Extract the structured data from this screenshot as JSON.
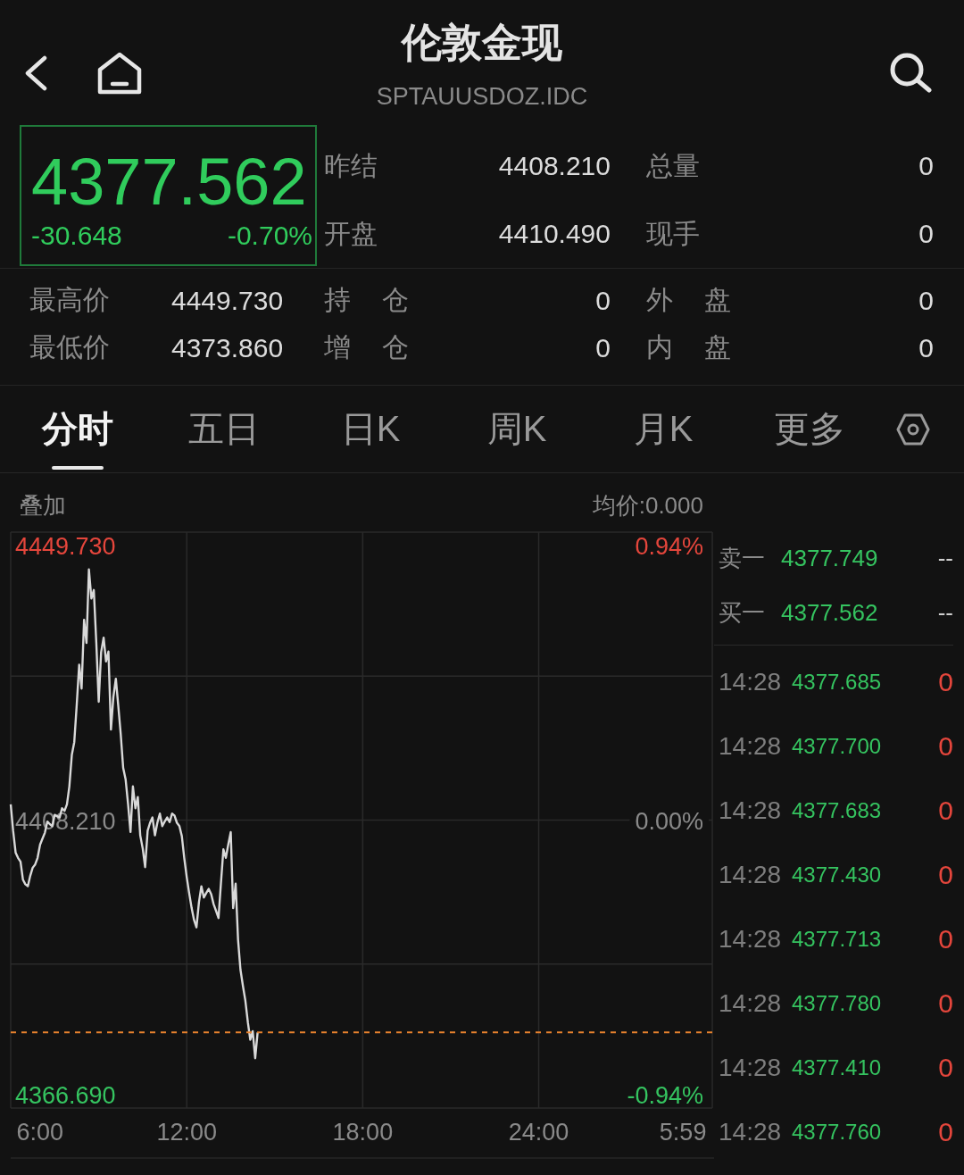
{
  "header": {
    "title": "伦敦金现",
    "code": "SPTAUUSDOZ.IDC"
  },
  "quote": {
    "price": "4377.562",
    "change": "-30.648",
    "change_pct": "-0.70%",
    "rising": false
  },
  "stats": [
    {
      "label": "昨结",
      "value": "4408.210"
    },
    {
      "label": "总量",
      "value": "0"
    },
    {
      "label": "开盘",
      "value": "4410.490"
    },
    {
      "label": "现手",
      "value": "0"
    }
  ],
  "details": [
    {
      "label": "最高价",
      "value": "4449.730"
    },
    {
      "label": "持 仓",
      "value": "0"
    },
    {
      "label": "外 盘",
      "value": "0"
    },
    {
      "label": "最低价",
      "value": "4373.860"
    },
    {
      "label": "增 仓",
      "value": "0"
    },
    {
      "label": "内 盘",
      "value": "0"
    }
  ],
  "tabs": [
    {
      "label": "分时",
      "selected": true
    },
    {
      "label": "五日",
      "selected": false
    },
    {
      "label": "日K",
      "selected": false
    },
    {
      "label": "周K",
      "selected": false
    },
    {
      "label": "月K",
      "selected": false
    },
    {
      "label": "更多",
      "selected": false
    }
  ],
  "chart": {
    "overlay": "叠加",
    "average": "均价:0.000",
    "percent_labels": [
      "0.94%",
      "0.00%",
      "-0.94%"
    ],
    "chart_data": {
      "type": "line",
      "categories": [
        null,
        null,
        null,
        null,
        null,
        null,
        null,
        null,
        null,
        null,
        null,
        null,
        "6:00",
        null,
        null,
        null,
        null,
        null,
        null,
        null,
        null,
        null,
        null,
        null,
        null,
        null,
        null,
        null,
        null,
        null,
        null,
        null,
        null,
        null,
        null,
        null,
        null,
        null,
        null,
        null,
        null,
        null,
        null,
        null,
        null,
        null,
        null,
        null,
        null,
        null,
        null,
        null,
        null,
        null,
        null,
        null,
        null,
        null,
        null,
        null,
        null,
        null,
        null,
        null,
        null,
        null,
        null,
        null,
        null,
        null,
        null,
        null,
        "12:00",
        null,
        null,
        null,
        null,
        null,
        null,
        null,
        null,
        null,
        null,
        null,
        null,
        null,
        null,
        null,
        null,
        null,
        null,
        null,
        null,
        null,
        null,
        null,
        null,
        null,
        null,
        null,
        null,
        null,
        null,
        null,
        null,
        null,
        null,
        null,
        null,
        null,
        null,
        null,
        null,
        null,
        null,
        null,
        null,
        null,
        null,
        null,
        null,
        null,
        null,
        null,
        null,
        null,
        null,
        null,
        null,
        null,
        null,
        null,
        null,
        null,
        null,
        null,
        null,
        null,
        null,
        null,
        null,
        null,
        null,
        null,
        "18:00",
        null,
        null,
        null,
        null,
        null,
        null,
        null,
        null,
        null,
        null,
        null,
        null,
        null,
        null,
        null,
        null,
        null,
        null,
        null,
        null,
        null,
        null,
        null,
        null,
        null,
        null,
        null,
        null,
        null,
        null,
        null,
        null,
        null,
        null,
        null,
        null,
        null,
        null,
        null,
        null,
        null,
        null,
        null,
        null,
        null,
        null,
        null,
        null,
        null,
        null,
        null,
        null,
        null,
        null,
        null,
        null,
        null,
        null,
        null,
        null,
        null,
        null,
        null,
        null,
        null,
        null,
        null,
        null,
        null,
        null,
        null,
        "24:00",
        null,
        null,
        null,
        null,
        null,
        null,
        null,
        null,
        null,
        null,
        null,
        null,
        null,
        null,
        null,
        null,
        null,
        null,
        null,
        null,
        null,
        null,
        null,
        null,
        null,
        null,
        null,
        null,
        null,
        null,
        null,
        null,
        null,
        null,
        null,
        null,
        null,
        null,
        null,
        null,
        null,
        null,
        null,
        null,
        null,
        null,
        null,
        null,
        null,
        null,
        null,
        null,
        null,
        null,
        null,
        null,
        null,
        null,
        "5:59",
        null,
        null,
        null,
        null,
        null,
        null,
        null,
        null,
        null,
        null,
        null,
        null
      ],
      "series": [
        {
          "color": "#d9d9d9",
          "values": [
            4410.6,
            4406.6,
            4403.3,
            4402.5,
            4401.9,
            4399.2,
            4398.5,
            4398.2,
            4399.8,
            4401.0,
            4401.5,
            4402.5,
            4404.5,
            4405.4,
            4406.3,
            4408.0,
            4407.6,
            4407.3,
            4409.0,
            4408.8,
            4408.6,
            4410.0,
            4409.6,
            4410.6,
            4413.3,
            4418.1,
            4420.0,
            4425.5,
            4431.7,
            4428.1,
            4438.5,
            4435.0,
            4446.1,
            4441.7,
            4443.0,
            4435.0,
            4426.1,
            4433.6,
            4435.8,
            4432.2,
            4433.7,
            4421.9,
            4426.8,
            4429.6,
            4425.5,
            4421.3,
            4416.1,
            4414.4,
            4410.6,
            4406.4,
            4413.3,
            4410.0,
            4411.7,
            4405.9,
            4403.9,
            4401.1,
            4406.6,
            4407.8,
            4408.6,
            4405.9,
            4407.8,
            4409.2,
            4407.3,
            4408.0,
            4408.6,
            4407.9,
            4409.2,
            4408.9,
            4407.8,
            4407.3,
            4405.8,
            4402.5,
            4399.6,
            4397.2,
            4394.9,
            4393.1,
            4392.0,
            4395.8,
            4398.2,
            4396.5,
            4397.2,
            4397.8,
            4397.0,
            4395.5,
            4394.5,
            4393.4,
            4398.6,
            4403.8,
            4402.5,
            4404.5,
            4406.4,
            4394.9,
            4398.6,
            4390.1,
            4385.6,
            4383.1,
            4380.9,
            4377.6,
            4375.0,
            4376.3,
            4372.2,
            4376.1,
            null,
            null,
            null,
            null,
            null,
            null,
            null,
            null,
            null,
            null,
            null,
            null,
            null,
            null,
            null,
            null,
            null,
            null,
            null,
            null,
            null,
            null,
            null,
            null,
            null,
            null,
            null,
            null,
            null,
            null,
            null,
            null,
            null,
            null,
            null,
            null,
            null,
            null,
            null,
            null,
            null,
            null,
            null,
            null,
            null,
            null,
            null,
            null,
            null,
            null,
            null,
            null,
            null,
            null,
            null,
            null,
            null,
            null,
            null,
            null,
            null,
            null,
            null,
            null,
            null,
            null,
            null,
            null,
            null,
            null,
            null,
            null,
            null,
            null,
            null,
            null,
            null,
            null,
            null,
            null,
            null,
            null,
            null,
            null,
            null,
            null,
            null,
            null,
            null,
            null,
            null,
            null,
            null,
            null,
            null,
            null,
            null,
            null,
            null,
            null,
            null,
            null,
            null,
            null,
            null,
            null,
            null,
            null,
            null,
            null,
            null,
            null,
            null,
            null,
            null,
            null,
            null,
            null,
            null,
            null,
            null,
            null,
            null,
            null,
            null,
            null,
            null,
            null,
            null,
            null,
            null,
            null,
            null,
            null,
            null,
            null,
            null,
            null,
            null,
            null,
            null,
            null,
            null,
            null,
            null,
            null,
            null,
            null,
            null,
            null,
            null,
            null,
            null,
            null,
            null,
            null,
            null,
            null,
            null,
            null,
            null,
            null,
            null,
            null,
            null,
            null,
            null,
            null,
            null,
            null,
            null,
            null,
            null,
            null,
            null,
            null,
            null,
            null,
            null,
            null,
            null,
            null,
            null,
            null,
            null,
            null
          ]
        }
      ],
      "ref_lines": [
        {
          "axis": "y",
          "value": 4376.1,
          "color": "#e8822e"
        }
      ],
      "ylim": [
        4364.67,
        4451.75
      ],
      "yticks": [
        {
          "value": 4449.73,
          "label": "4449.730"
        },
        {
          "value": 4408.21,
          "label": "4408.210"
        },
        {
          "value": 4366.69,
          "label": "4366.690"
        }
      ]
    }
  },
  "order_book": [
    {
      "label": "卖一",
      "price": "4377.749",
      "volume": "--"
    },
    {
      "label": "买一",
      "price": "4377.562",
      "volume": "--"
    }
  ],
  "trades": [
    {
      "time": "14:28",
      "price": "4377.685",
      "volume": "0"
    },
    {
      "time": "14:28",
      "price": "4377.700",
      "volume": "0"
    },
    {
      "time": "14:28",
      "price": "4377.683",
      "volume": "0"
    },
    {
      "time": "14:28",
      "price": "4377.430",
      "volume": "0"
    },
    {
      "time": "14:28",
      "price": "4377.713",
      "volume": "0"
    },
    {
      "time": "14:28",
      "price": "4377.780",
      "volume": "0"
    },
    {
      "time": "14:28",
      "price": "4377.410",
      "volume": "0"
    },
    {
      "time": "14:28",
      "price": "4377.760",
      "volume": "0"
    }
  ]
}
